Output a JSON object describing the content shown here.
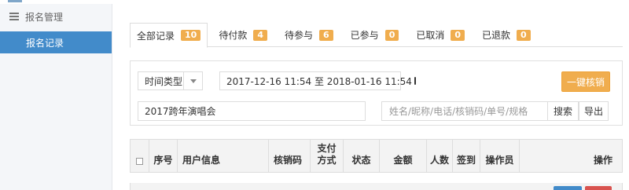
{
  "sidebar": {
    "group_label": "报名管理",
    "items": [
      {
        "label": "报名记录",
        "active": true
      }
    ]
  },
  "tabs": [
    {
      "label": "全部记录",
      "count": "10",
      "active": true
    },
    {
      "label": "待付款",
      "count": "4"
    },
    {
      "label": "待参与",
      "count": "6"
    },
    {
      "label": "已参与",
      "count": "0"
    },
    {
      "label": "已取消",
      "count": "0"
    },
    {
      "label": "已退款",
      "count": "0"
    }
  ],
  "filters": {
    "time_type": "时间类型",
    "date_range": "2017-12-16 11:54 至 2018-01-16 11:54",
    "verify_button": "一键核销",
    "event_name": "2017跨年演唱会",
    "search_placeholder": "姓名/昵称/电话/核销码/单号/规格",
    "search_button": "搜索",
    "export_button": "导出"
  },
  "table": {
    "headers": [
      "序号",
      "用户信息",
      "核销码",
      "支付方式",
      "状态",
      "金额",
      "人数",
      "签到",
      "操作员",
      "操作"
    ]
  },
  "colors": {
    "sidebar_active": "#428bca",
    "badge": "#f0ad4e",
    "primary": "#428bca",
    "danger": "#d9534f"
  }
}
